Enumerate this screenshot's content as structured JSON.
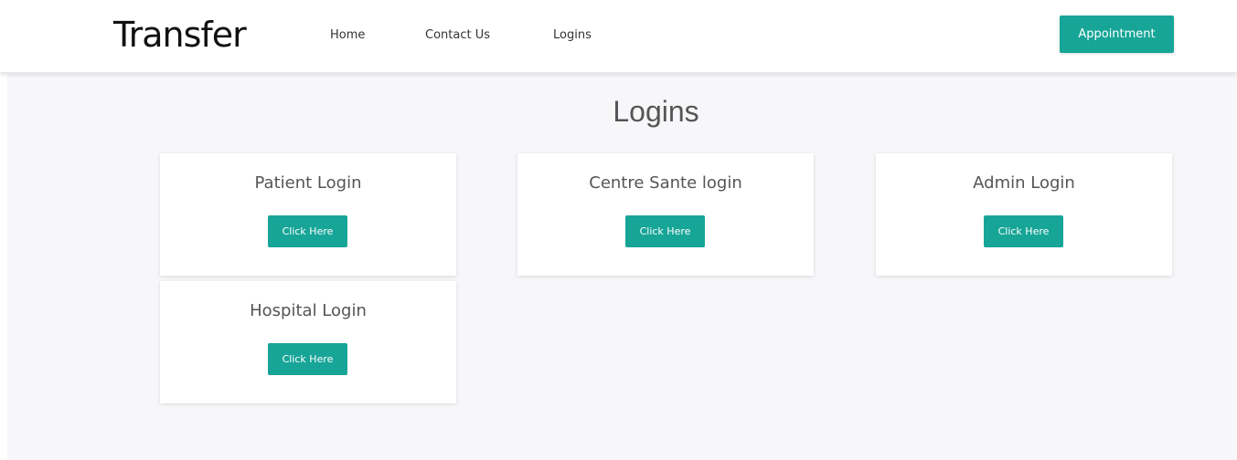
{
  "navbar": {
    "brand": "Transfer",
    "links": [
      {
        "label": "Home"
      },
      {
        "label": "Contact Us"
      },
      {
        "label": "Logins"
      }
    ],
    "appointment_label": "Appointment"
  },
  "main": {
    "title": "Logins",
    "cards": [
      {
        "title": "Patient Login",
        "button_label": "Click Here"
      },
      {
        "title": "Centre Sante login",
        "button_label": "Click Here"
      },
      {
        "title": "Admin Login",
        "button_label": "Click Here"
      },
      {
        "title": "Hospital Login",
        "button_label": "Click Here"
      }
    ]
  },
  "colors": {
    "accent": "#17a597",
    "background": "#f7f7fa",
    "card": "#ffffff",
    "text": "#555555"
  }
}
